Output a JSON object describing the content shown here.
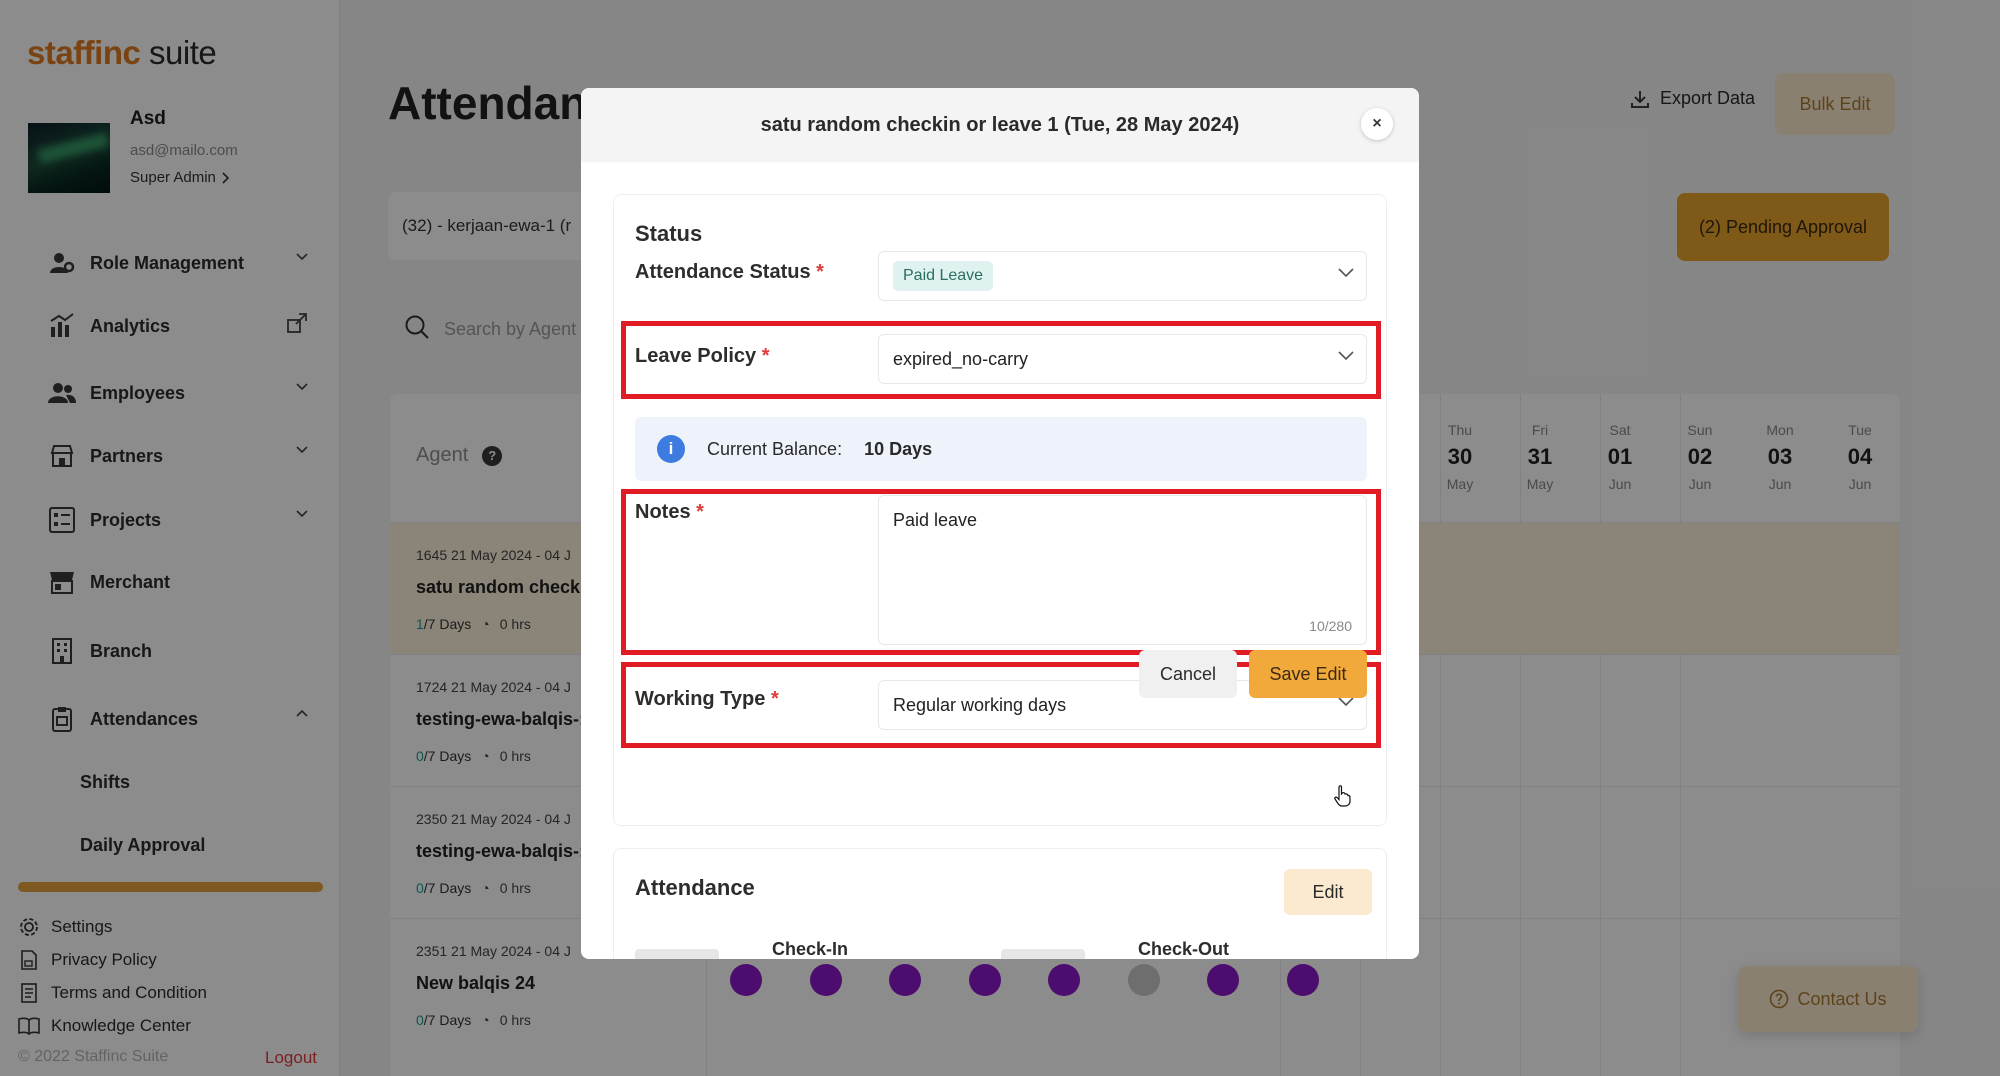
{
  "sidebar": {
    "logo": {
      "brand": "staffinc",
      "suite": " suite"
    },
    "profile": {
      "name": "Asd",
      "email": "asd@mailo.com",
      "role": "Super Admin"
    },
    "nav": [
      {
        "label": "Role Management",
        "icon": "user-gear-icon",
        "trail": "chevron-down"
      },
      {
        "label": "Analytics",
        "icon": "bar-chart-icon",
        "trail": "external-link"
      },
      {
        "label": "Employees",
        "icon": "users-icon",
        "trail": "chevron-down"
      },
      {
        "label": "Partners",
        "icon": "store-icon",
        "trail": "chevron-down"
      },
      {
        "label": "Projects",
        "icon": "list-icon",
        "trail": "chevron-down"
      },
      {
        "label": "Merchant",
        "icon": "shop-icon",
        "trail": ""
      },
      {
        "label": "Branch",
        "icon": "building-icon",
        "trail": ""
      },
      {
        "label": "Attendances",
        "icon": "clipboard-icon",
        "trail": "chevron-up"
      }
    ],
    "subnav": [
      "Shifts",
      "Daily Approval"
    ],
    "footer": [
      {
        "label": "Settings",
        "icon": "gear-icon"
      },
      {
        "label": "Privacy Policy",
        "icon": "lock-doc-icon"
      },
      {
        "label": "Terms and Condition",
        "icon": "doc-icon"
      },
      {
        "label": "Knowledge Center",
        "icon": "book-icon"
      }
    ],
    "copyright": "© 2022 Staffinc Suite",
    "logout": "Logout"
  },
  "main": {
    "title": "Attendan",
    "export_label": "Export Data",
    "bulk_label": "Bulk Edit",
    "filter_text": "(32) - kerjaan-ewa-1 (r",
    "pending_label": "(2) Pending Approval",
    "search_placeholder": "Search by Agent",
    "agent_header": "Agent",
    "days": [
      {
        "d": "Thu",
        "n": "30",
        "m": "May"
      },
      {
        "d": "Fri",
        "n": "31",
        "m": "May"
      },
      {
        "d": "Sat",
        "n": "01",
        "m": "Jun"
      },
      {
        "d": "Sun",
        "n": "02",
        "m": "Jun"
      },
      {
        "d": "Mon",
        "n": "03",
        "m": "Jun"
      },
      {
        "d": "Tue",
        "n": "04",
        "m": "Jun"
      }
    ],
    "rows": [
      {
        "meta": "1645   21 May 2024 - 04 J",
        "name": "satu random checki",
        "count": "1",
        "total": "/7 Days",
        "hours": "0 hrs"
      },
      {
        "meta": "1724   21 May 2024 - 04 J",
        "name": "testing-ewa-balqis-:",
        "count": "0",
        "total": "/7 Days",
        "hours": "0 hrs"
      },
      {
        "meta": "2350   21 May 2024 - 04 J",
        "name": "testing-ewa-balqis-:",
        "count": "0",
        "total": "/7 Days",
        "hours": "0 hrs"
      },
      {
        "meta": "2351   21 May 2024 - 04 J",
        "name": "New balqis 24",
        "count": "0",
        "total": "/7 Days",
        "hours": "0 hrs"
      }
    ],
    "contact_label": "Contact Us"
  },
  "modal": {
    "title": "satu random checkin or leave 1 (Tue, 28 May 2024)",
    "close": "×",
    "status_section": "Status",
    "attendance_status_label": "Attendance Status",
    "attendance_status_value": "Paid Leave",
    "leave_policy_label": "Leave Policy",
    "leave_policy_value": "expired_no-carry",
    "balance_label": "Current Balance:",
    "balance_value": "10 Days",
    "notes_label": "Notes",
    "notes_value": "Paid leave",
    "notes_counter": "10/280",
    "working_type_label": "Working Type",
    "working_type_value": "Regular working days",
    "required_mark": "*",
    "cancel_label": "Cancel",
    "save_label": "Save Edit",
    "attendance_section": "Attendance",
    "edit_label": "Edit",
    "checkin_label": "Check-In",
    "checkout_label": "Check-Out"
  },
  "colors": {
    "accent": "#f2a93b",
    "highlight": "#e01b24",
    "purple_dot": "#8a18c9"
  }
}
